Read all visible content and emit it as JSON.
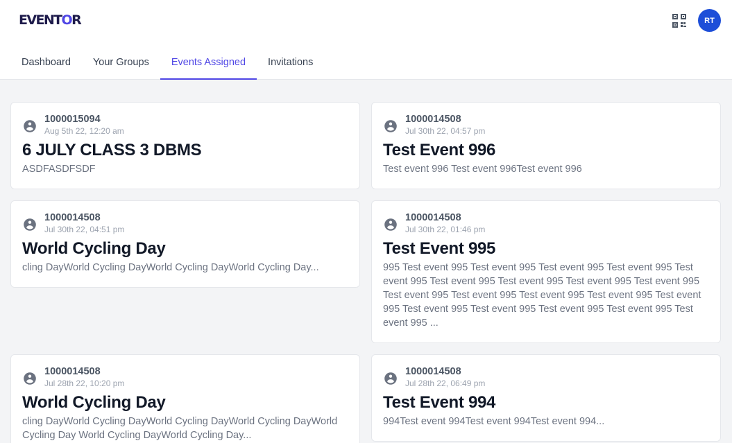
{
  "app": {
    "logo_prefix": "EVENT",
    "logo_o": "O",
    "logo_suffix": "R"
  },
  "header": {
    "avatar_initials": "RT"
  },
  "tabs": [
    {
      "label": "Dashboard"
    },
    {
      "label": "Your Groups"
    },
    {
      "label": "Events Assigned",
      "active": true
    },
    {
      "label": "Invitations"
    }
  ],
  "events": [
    {
      "user_id": "1000015094",
      "timestamp": "Aug 5th 22, 12:20 am",
      "title": "6 JULY CLASS 3 DBMS",
      "description": "ASDFASDFSDF"
    },
    {
      "user_id": "1000014508",
      "timestamp": "Jul 30th 22, 04:57 pm",
      "title": "Test Event 996",
      "description": "Test event 996 Test event 996Test event 996"
    },
    {
      "user_id": "1000014508",
      "timestamp": "Jul 30th 22, 04:51 pm",
      "title": "World Cycling Day",
      "description": "cling DayWorld Cycling DayWorld Cycling DayWorld Cycling Day..."
    },
    {
      "user_id": "1000014508",
      "timestamp": "Jul 30th 22, 01:46 pm",
      "title": "Test Event 995",
      "description": "995 Test event 995 Test event 995 Test event 995 Test event 995 Test event 995 Test event 995 Test event 995 Test event 995 Test event 995 Test event 995 Test event 995 Test event 995 Test event 995 Test event 995 Test event 995 Test event 995 Test event 995 Test event 995 Test event 995 ..."
    },
    {
      "user_id": "1000014508",
      "timestamp": "Jul 28th 22, 10:20 pm",
      "title": "World Cycling Day",
      "description": "cling DayWorld Cycling DayWorld Cycling DayWorld Cycling DayWorld Cycling Day World Cycling DayWorld Cycling Day..."
    },
    {
      "user_id": "1000014508",
      "timestamp": "Jul 28th 22, 06:49 pm",
      "title": "Test Event 994",
      "description": "994Test event 994Test event 994Test event 994..."
    }
  ]
}
